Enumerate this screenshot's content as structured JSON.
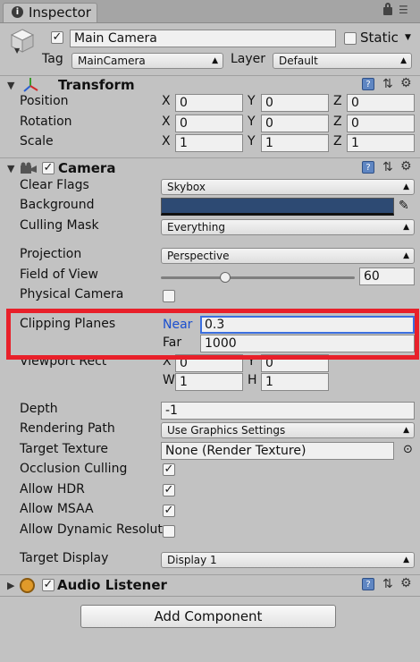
{
  "tab": {
    "label": "Inspector"
  },
  "gameobject": {
    "name": "Main Camera",
    "static_label": "Static",
    "tag_label": "Tag",
    "tag_value": "MainCamera",
    "layer_label": "Layer",
    "layer_value": "Default"
  },
  "transform": {
    "title": "Transform",
    "rows": [
      {
        "label": "Position",
        "x": "0",
        "y": "0",
        "z": "0"
      },
      {
        "label": "Rotation",
        "x": "0",
        "y": "0",
        "z": "0"
      },
      {
        "label": "Scale",
        "x": "1",
        "y": "1",
        "z": "1"
      }
    ],
    "axis": {
      "x": "X",
      "y": "Y",
      "z": "Z"
    }
  },
  "camera": {
    "title": "Camera",
    "clear_flags": {
      "label": "Clear Flags",
      "value": "Skybox"
    },
    "background": {
      "label": "Background",
      "color": "#2d4a73"
    },
    "culling_mask": {
      "label": "Culling Mask",
      "value": "Everything"
    },
    "projection": {
      "label": "Projection",
      "value": "Perspective"
    },
    "fov": {
      "label": "Field of View",
      "value": "60",
      "slider_fraction": 0.33
    },
    "physical_camera": {
      "label": "Physical Camera"
    },
    "clipping": {
      "label": "Clipping Planes",
      "near_label": "Near",
      "near_value": "0.3",
      "far_label": "Far",
      "far_value": "1000"
    },
    "viewport": {
      "label": "Viewport Rect",
      "x": "0",
      "y": "0",
      "w": "1",
      "h": "1",
      "x_lbl": "X",
      "y_lbl": "Y",
      "w_lbl": "W",
      "h_lbl": "H"
    },
    "depth": {
      "label": "Depth",
      "value": "-1"
    },
    "rendering_path": {
      "label": "Rendering Path",
      "value": "Use Graphics Settings"
    },
    "target_texture": {
      "label": "Target Texture",
      "value": "None (Render Texture)"
    },
    "occlusion_culling": {
      "label": "Occlusion Culling"
    },
    "allow_hdr": {
      "label": "Allow HDR"
    },
    "allow_msaa": {
      "label": "Allow MSAA"
    },
    "allow_dynamic": {
      "label": "Allow Dynamic Resolut"
    },
    "target_display": {
      "label": "Target Display",
      "value": "Display 1"
    }
  },
  "audio_listener": {
    "title": "Audio Listener"
  },
  "add_component": {
    "label": "Add Component"
  },
  "colors": {
    "highlight": "#e8202a",
    "accent_blue": "#1a4fcf"
  }
}
